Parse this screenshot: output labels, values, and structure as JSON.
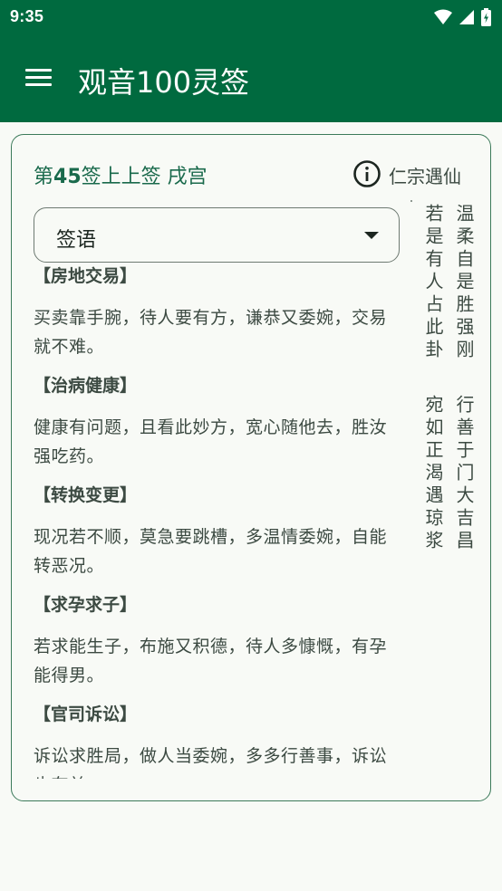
{
  "status": {
    "time": "9:35"
  },
  "app_bar": {
    "title": "观音100灵签"
  },
  "sign": {
    "prefix": "第",
    "number": "45",
    "suffix": "签上上签 戌宫",
    "legend": "仁宗遇仙"
  },
  "select": {
    "value": "签语"
  },
  "sections": [
    {
      "head": "【房地交易】",
      "body": "买卖靠手腕，待人要有方，谦恭又委婉，交易就不难。"
    },
    {
      "head": "【治病健康】",
      "body": "健康有问题，且看此妙方，宽心随他去，胜汝强吃药。"
    },
    {
      "head": "【转换变更】",
      "body": "现况若不顺，莫急要跳槽，多温情委婉，自能转恶况。"
    },
    {
      "head": "【求孕求子】",
      "body": "若求能生子，布施又积德，待人多慷慨，有孕能得男。"
    },
    {
      "head": "【官司诉讼】",
      "body": "诉讼求胜局，做人当委婉，多多行善事，诉讼也有益。"
    }
  ],
  "poem": {
    "col1_top": "温柔自是胜强刚",
    "col1_bottom": "行善于门大吉昌",
    "col2_top": "若是有人占此卦",
    "col2_bottom": "宛如正渴遇琼浆"
  },
  "colors": {
    "primary": "#006a3f",
    "title_green": "#1a6a4c",
    "text": "#3c4a42"
  }
}
